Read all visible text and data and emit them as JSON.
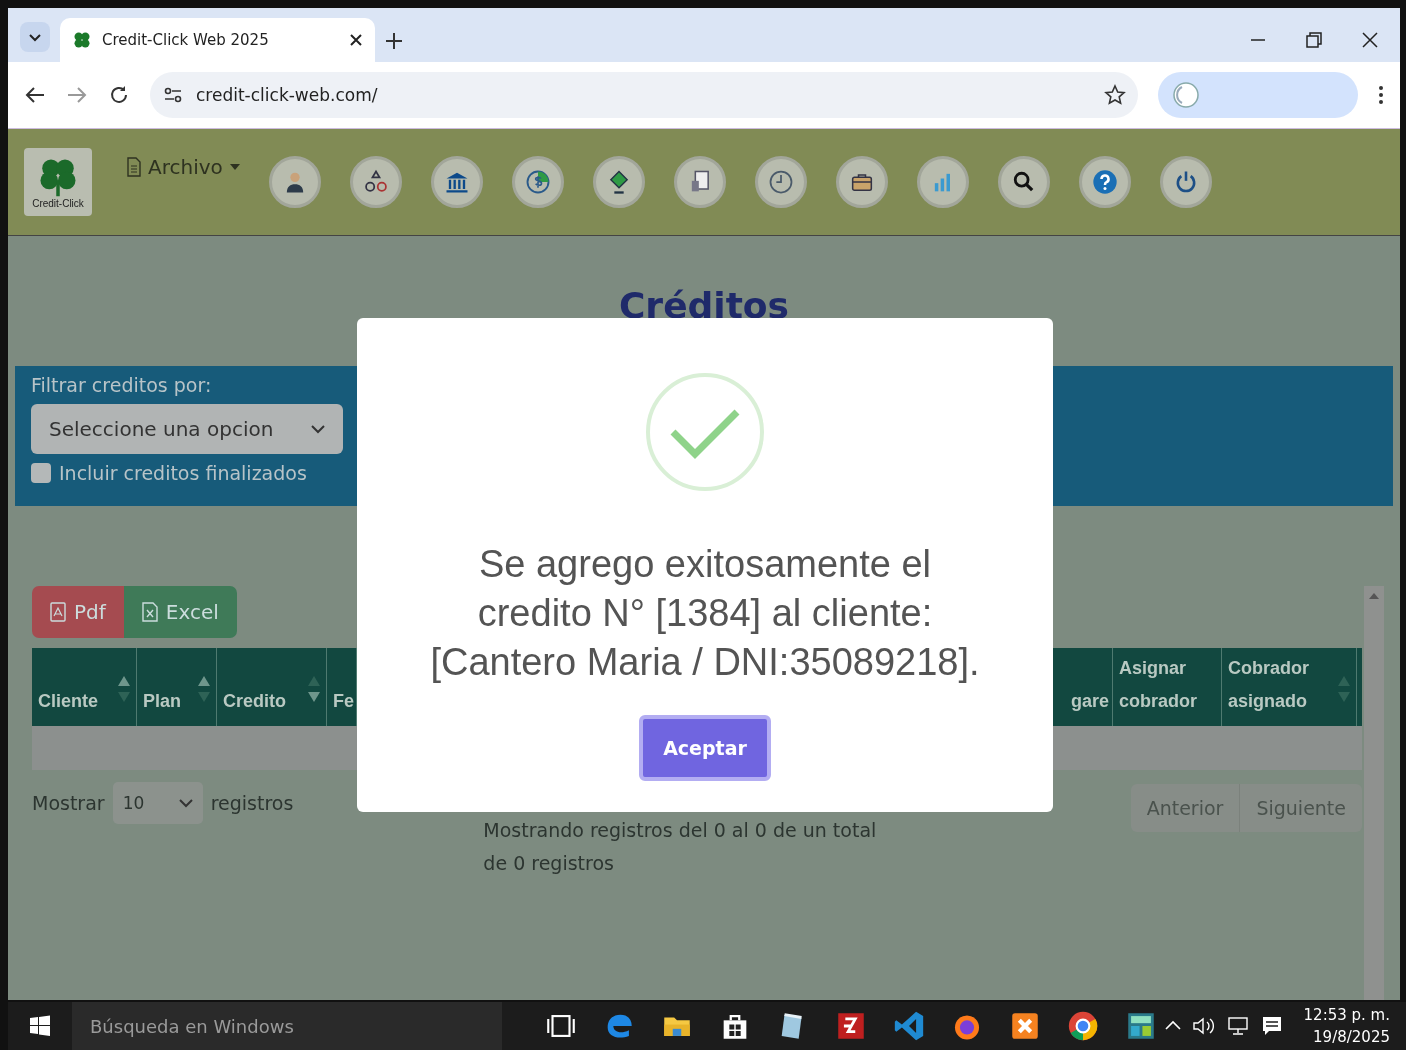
{
  "browser": {
    "tab_title": "Credit-Click Web 2025",
    "url": "credit-click-web.com/"
  },
  "nav": {
    "logo_text": "Credit-Click",
    "menu": "Archivo"
  },
  "page_title": "Créditos",
  "filter": {
    "label": "Filtrar creditos por:",
    "select_value": "Seleccione una opcion",
    "checkbox_label": "Incluir creditos finalizados",
    "checked": false
  },
  "export_buttons": [
    {
      "kind": "pdf",
      "label": "Pdf"
    },
    {
      "kind": "excel",
      "label": "Excel"
    }
  ],
  "table": {
    "columns": [
      {
        "label": "Cliente",
        "sorted_up": true,
        "sorted_down": false
      },
      {
        "label": "Plan",
        "sorted_up": true,
        "sorted_down": false
      },
      {
        "label": "Credito",
        "sorted_up": false,
        "sorted_down": true
      },
      {
        "label": "Fe"
      },
      {
        "label": "gare"
      },
      {
        "label": "Asignar cobrador"
      },
      {
        "label": "Cobrador asignado",
        "sorted_up": false,
        "sorted_down": false
      }
    ]
  },
  "length": {
    "before": "Mostrar",
    "value": "10",
    "after": "registros"
  },
  "info": "Mostrando registros del 0 al 0 de un total de 0 registros",
  "pagination": [
    "Anterior",
    "Siguiente"
  ],
  "modal": {
    "message": "Se agrego exitosamente el credito N° [1384] al cliente: [Cantero Maria / DNI:35089218].",
    "button": "Aceptar"
  },
  "taskbar": {
    "search_placeholder": "Búsqueda en Windows",
    "time": "12:53 p. m.",
    "date": "19/8/2025"
  }
}
